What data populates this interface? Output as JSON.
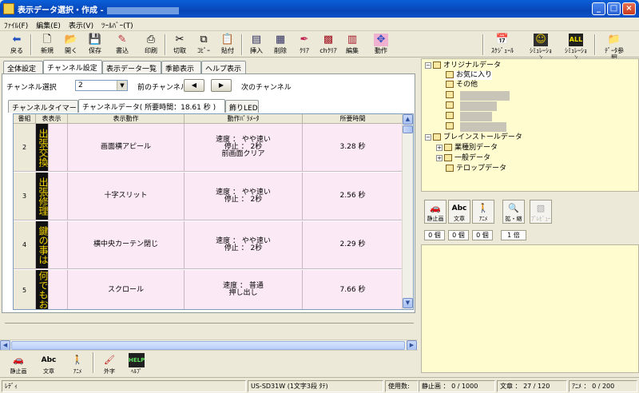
{
  "window": {
    "title": "表示データ選択・作成 -",
    "min_label": "_",
    "max_label": "□",
    "close_label": "×"
  },
  "menu": [
    "ﾌｧｲﾙ(F)",
    "編集(E)",
    "表示(V)",
    "ﾂｰﾙﾊﾞｰ(T)"
  ],
  "toolbar": {
    "back": "戻る",
    "new": "新規",
    "open": "開く",
    "save": "保存",
    "write": "書込",
    "print": "印刷",
    "cut": "切取",
    "copy": "ｺﾋﾟｰ",
    "paste": "貼付",
    "insert": "挿入",
    "delete": "削除",
    "clear": "ｸﾘｱ",
    "ch_clear": "chｸﾘｱ",
    "edit": "編集",
    "action": "動作",
    "schedule": "ｽｹｼﾞｭｰﾙ",
    "sim1": "ｼﾐｭﾚｰｼｮﾝ",
    "sim2": "ｼﾐｭﾚｰｼｮﾝ",
    "data_ref": "ﾃﾞｰﾀ参照"
  },
  "main_tabs": [
    "全体設定",
    "チャンネル設定",
    "表示データ一覧",
    "季節表示",
    "ヘルプ表示"
  ],
  "channel": {
    "select_label": "チャンネル選択",
    "select_value": "2",
    "prev_label": "前のチャンネル",
    "next_label": "次のチャンネル",
    "prev_arrow": "◀",
    "next_arrow": "▶"
  },
  "sub_tabs": [
    "チャンネルタイマー",
    "チャンネルデータ( 所要時間：18.61 秒 )",
    "飾りLED"
  ],
  "table": {
    "headers": [
      "番組",
      "表表示",
      "表示動作",
      "動作ﾊﾟﾗﾒｰﾀ",
      "所要時間"
    ],
    "rows": [
      {
        "num": "2",
        "thumb": "出張交換",
        "action": "画面横アピール",
        "params": "速度 ： やや速い\n停止 ： 2秒\n前画面クリア",
        "time": "3.28 秒"
      },
      {
        "num": "3",
        "thumb": "出張修理",
        "action": "十字スリット",
        "params": "速度 ： やや速い\n停止 ： 2秒",
        "time": "2.56 秒"
      },
      {
        "num": "4",
        "thumb": "鍵の事は",
        "action": "横中央カーテン閉じ",
        "params": "速度 ： やや速い\n停止 ： 2秒",
        "time": "2.29 秒"
      },
      {
        "num": "5",
        "thumb": "何でもお",
        "action": "スクロール",
        "params": "速度 ： 普通\n押し出し",
        "time": "7.66 秒"
      }
    ]
  },
  "tree": {
    "original": "オリジナルデータ",
    "favorites": "お気に入り",
    "other": "その他",
    "brainstorm": "ブレインストールデータ",
    "industry": "業種別データ",
    "general": "一般データ",
    "telop": "テロップデータ"
  },
  "mid_tools": {
    "still": "静止画",
    "text": "文章",
    "anime": "ｱﾆﾒ",
    "zoom": "拡・縮",
    "preview": "ﾌﾟﾚﾋﾞｭｰ",
    "count_still": "0 個",
    "count_text": "0 個",
    "count_anime": "0 個",
    "zoom_value": "1 倍"
  },
  "bottom_tools": {
    "still": "静止画",
    "text": "文章",
    "anime": "ｱﾆﾒ",
    "gaiji": "外字",
    "help": "ﾍﾙﾌﾟ"
  },
  "status": {
    "ready": "ﾚﾃﾞｨ",
    "model": "US-SD31W (1文字3段 ﾀﾃ)",
    "usage": "使用数:",
    "still": "静止画 ： 0 / 1000",
    "text": "文章 ： 27 / 120",
    "anime": "ｱﾆﾒ ： 0 / 200"
  }
}
